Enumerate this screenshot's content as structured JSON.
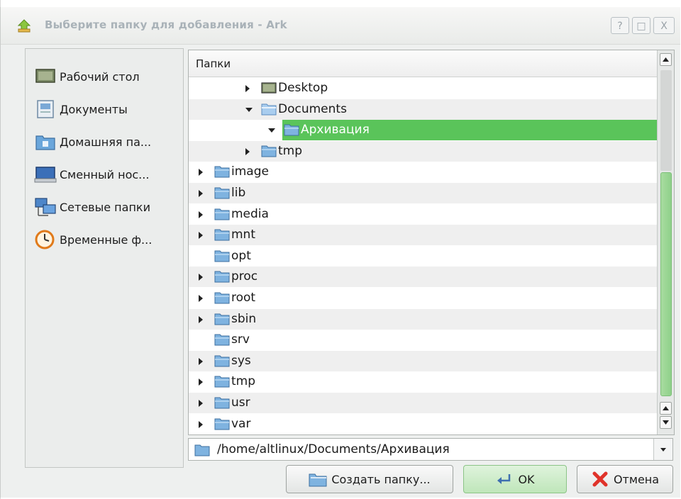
{
  "window": {
    "title": "Выберите папку для добавления - Ark",
    "help_label": "?",
    "maximize_label": "□",
    "close_label": "X"
  },
  "places": [
    {
      "label": "Рабочий стол",
      "icon": "desktop-icon"
    },
    {
      "label": "Документы",
      "icon": "documents-icon"
    },
    {
      "label": "Домашняя па...",
      "icon": "home-folder-icon"
    },
    {
      "label": "Сменный нос...",
      "icon": "removable-media-icon"
    },
    {
      "label": "Сетевые папки",
      "icon": "network-folders-icon"
    },
    {
      "label": "Временные ф...",
      "icon": "clock-icon"
    }
  ],
  "tree": {
    "header": "Папки",
    "rows": [
      {
        "label": "Desktop",
        "level": 3,
        "arrow": "right",
        "icon": "desktop"
      },
      {
        "label": "Documents",
        "level": 3,
        "arrow": "down",
        "icon": "folder-open"
      },
      {
        "label": "Архивация",
        "level": 4,
        "arrow": "down",
        "icon": "folder",
        "selected": true
      },
      {
        "label": "tmp",
        "level": 3,
        "arrow": "right",
        "icon": "folder"
      },
      {
        "label": "image",
        "level": 1,
        "arrow": "right",
        "icon": "folder"
      },
      {
        "label": "lib",
        "level": 1,
        "arrow": "right",
        "icon": "folder"
      },
      {
        "label": "media",
        "level": 1,
        "arrow": "right",
        "icon": "folder"
      },
      {
        "label": "mnt",
        "level": 1,
        "arrow": "right",
        "icon": "folder"
      },
      {
        "label": "opt",
        "level": 1,
        "arrow": "",
        "icon": "folder"
      },
      {
        "label": "proc",
        "level": 1,
        "arrow": "right",
        "icon": "folder"
      },
      {
        "label": "root",
        "level": 1,
        "arrow": "right",
        "icon": "folder"
      },
      {
        "label": "sbin",
        "level": 1,
        "arrow": "right",
        "icon": "folder"
      },
      {
        "label": "srv",
        "level": 1,
        "arrow": "",
        "icon": "folder"
      },
      {
        "label": "sys",
        "level": 1,
        "arrow": "right",
        "icon": "folder"
      },
      {
        "label": "tmp",
        "level": 1,
        "arrow": "right",
        "icon": "folder"
      },
      {
        "label": "usr",
        "level": 1,
        "arrow": "right",
        "icon": "folder"
      },
      {
        "label": "var",
        "level": 1,
        "arrow": "right",
        "icon": "folder"
      }
    ]
  },
  "path": {
    "value": "/home/altlinux/Documents/Архивация"
  },
  "buttons": {
    "new_folder": "Создать папку...",
    "ok": "OK",
    "cancel": "Отмена"
  },
  "colors": {
    "selection": "#5ac45a",
    "folder": "#7fb3e0",
    "scroll_thumb": "#8fd08a"
  }
}
